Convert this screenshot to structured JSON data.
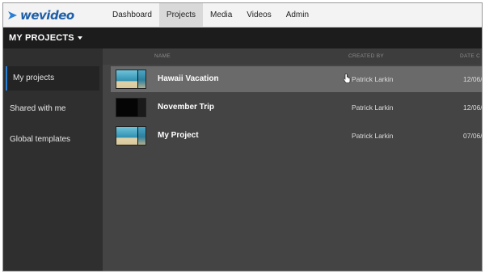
{
  "app": {
    "logo_text": "wevideo",
    "logo_icon": "wevideo-logo-icon"
  },
  "nav": {
    "items": [
      {
        "label": "Dashboard",
        "active": false
      },
      {
        "label": "Projects",
        "active": true
      },
      {
        "label": "Media",
        "active": false
      },
      {
        "label": "Videos",
        "active": false
      },
      {
        "label": "Admin",
        "active": false
      }
    ]
  },
  "header": {
    "title": "MY PROJECTS",
    "dropdown_icon": "caret-down-icon"
  },
  "sidebar": {
    "items": [
      {
        "label": "My projects",
        "active": true
      },
      {
        "label": "Shared with me",
        "active": false
      },
      {
        "label": "Global templates",
        "active": false
      }
    ]
  },
  "table": {
    "columns": {
      "name": "NAME",
      "created_by": "CREATED BY",
      "date": "DATE C"
    },
    "rows": [
      {
        "name": "Hawaii Vacation",
        "created_by": "Patrick Larkin",
        "date": "12/06/",
        "selected": true,
        "thumbnail": "beach"
      },
      {
        "name": "November Trip",
        "created_by": "Patrick Larkin",
        "date": "12/06/",
        "selected": false,
        "thumbnail": "black"
      },
      {
        "name": "My Project",
        "created_by": "Patrick Larkin",
        "date": "07/06/",
        "selected": false,
        "thumbnail": "beach"
      }
    ]
  },
  "colors": {
    "accent": "#2a7fd4",
    "logo": "#1f5fa8",
    "background": "#444444"
  }
}
